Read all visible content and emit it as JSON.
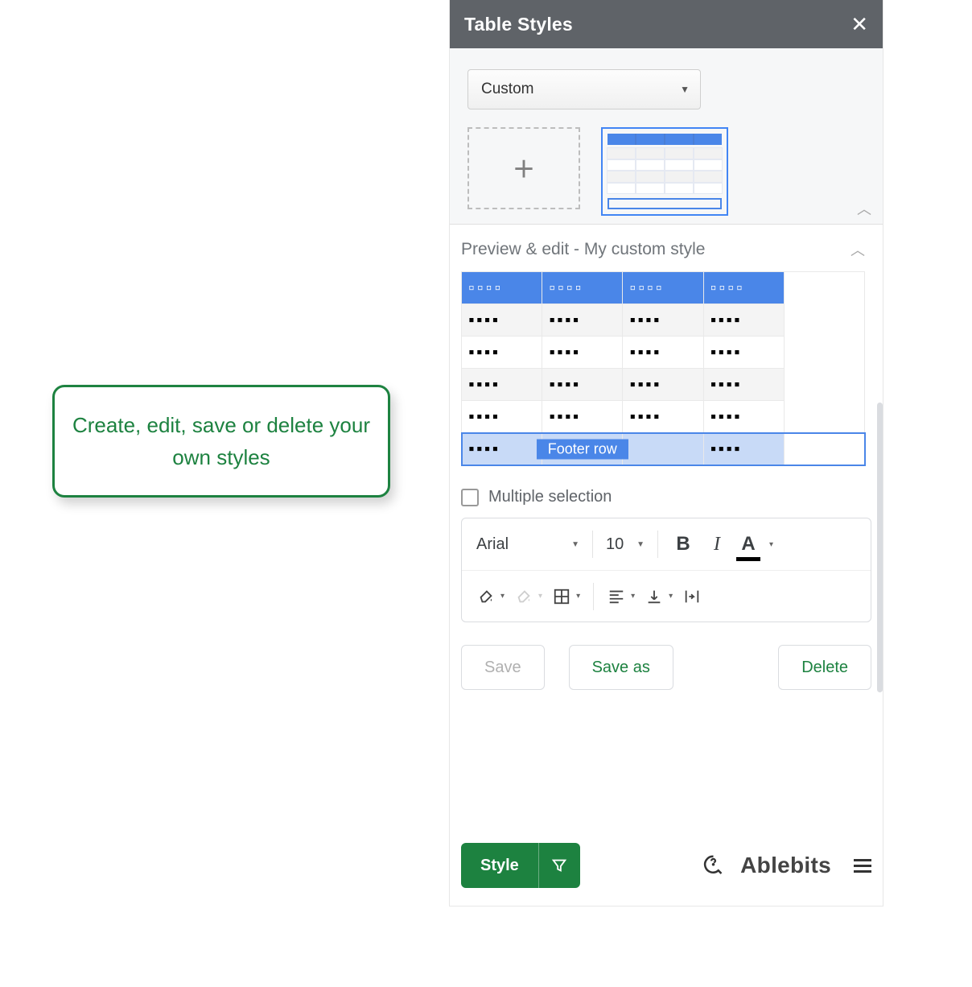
{
  "callout": {
    "text": "Create, edit, save or delete your own styles"
  },
  "panel": {
    "title": "Table Styles",
    "style_select": {
      "value": "Custom"
    },
    "section_title": "Preview & edit - My custom style",
    "tooltip": "Footer row",
    "multiple_selection_label": "Multiple selection",
    "font_name": "Arial",
    "font_size": "10",
    "buttons": {
      "save": "Save",
      "save_as": "Save as",
      "delete": "Delete"
    },
    "footer": {
      "style_label": "Style",
      "brand": "Ablebits"
    }
  }
}
